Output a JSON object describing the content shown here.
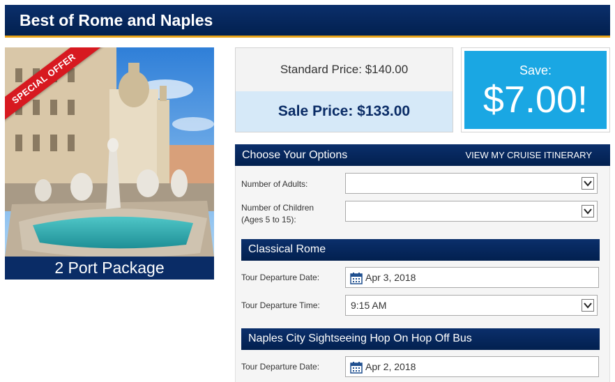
{
  "page": {
    "title": "Best of Rome and Naples"
  },
  "image": {
    "ribbon": "SPECIAL OFFER",
    "caption": "2 Port Package"
  },
  "pricing": {
    "standard": "Standard Price: $140.00",
    "sale": "Sale Price: $133.00",
    "save_label": "Save:",
    "save_amount": "$7.00!"
  },
  "options": {
    "header": "Choose Your Options",
    "itinerary_link": "VIEW MY CRUISE ITINERARY",
    "adults_label": "Number of Adults:",
    "adults_value": "",
    "children_label_1": "Number of Children",
    "children_label_2": "(Ages 5 to 15):",
    "children_value": ""
  },
  "tours": [
    {
      "title": "Classical Rome",
      "date_label": "Tour Departure Date:",
      "date_value": "Apr 3, 2018",
      "time_label": "Tour Departure Time:",
      "time_value": "9:15 AM"
    },
    {
      "title": "Naples City Sightseeing Hop On Hop Off Bus",
      "date_label": "Tour Departure Date:",
      "date_value": "Apr 2, 2018"
    }
  ],
  "colors": {
    "navy": "#0a2c66",
    "accent": "#e8a317",
    "save_bg": "#1aa7e3",
    "ribbon": "#d71920"
  },
  "icons": [
    "calendar-icon",
    "chevron-down-icon"
  ]
}
